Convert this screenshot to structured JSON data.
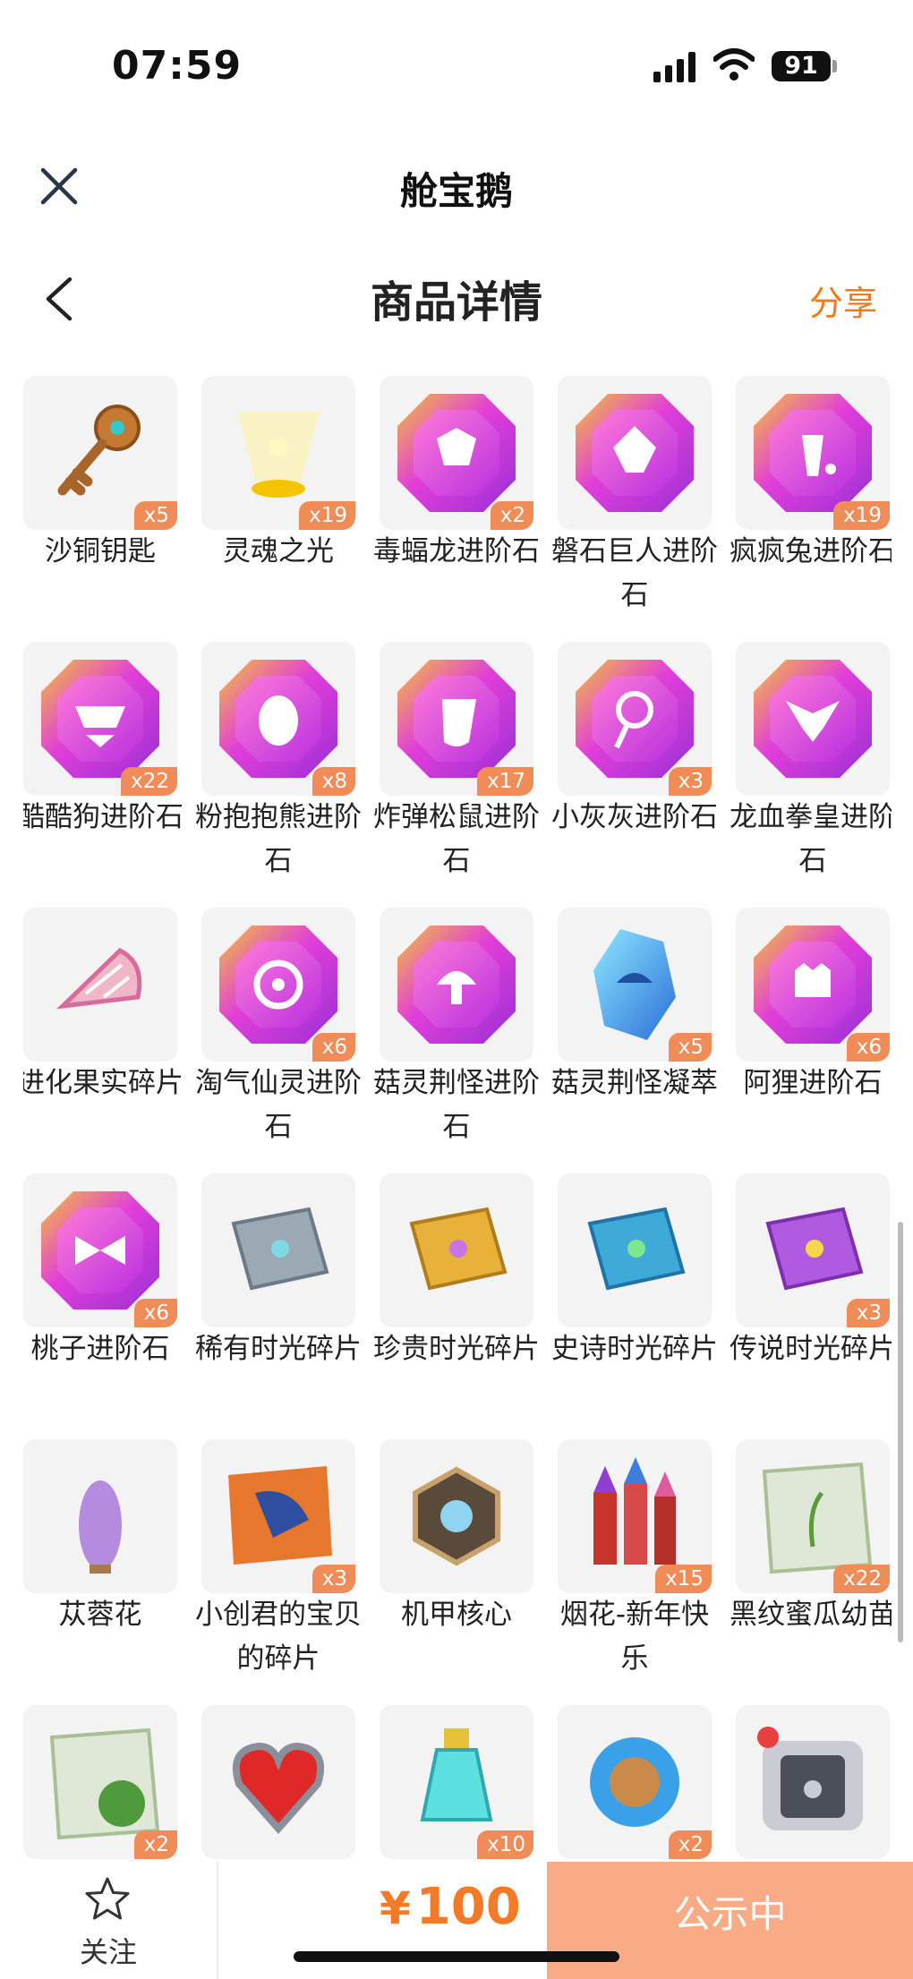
{
  "status_bar": {
    "time": "07:59",
    "battery": "91"
  },
  "header": {
    "app_title": "舱宝鹅",
    "close_icon": "close-icon"
  },
  "nav": {
    "title": "商品详情",
    "share_label": "分享",
    "back_icon": "chevron-left-icon"
  },
  "items": [
    {
      "name": "沙铜钥匙",
      "qty": "x5",
      "icon": "key-icon"
    },
    {
      "name": "灵魂之光",
      "qty": "x19",
      "icon": "light-icon"
    },
    {
      "name": "毒蝠龙进阶石",
      "qty": "x2",
      "icon": "gem-icon"
    },
    {
      "name": "磐石巨人进阶石",
      "qty": "",
      "icon": "gem-icon"
    },
    {
      "name": "疯疯兔进阶石",
      "qty": "x19",
      "icon": "gem-icon"
    },
    {
      "name": "酷酷狗进阶石",
      "qty": "x22",
      "icon": "gem-icon"
    },
    {
      "name": "粉抱抱熊进阶石",
      "qty": "x8",
      "icon": "gem-icon"
    },
    {
      "name": "炸弹松鼠进阶石",
      "qty": "x17",
      "icon": "gem-icon"
    },
    {
      "name": "小灰灰进阶石",
      "qty": "x3",
      "icon": "gem-icon"
    },
    {
      "name": "龙血拳皇进阶石",
      "qty": "",
      "icon": "gem-icon"
    },
    {
      "name": "进化果实碎片",
      "qty": "",
      "icon": "fruit-slice-icon"
    },
    {
      "name": "淘气仙灵进阶石",
      "qty": "x6",
      "icon": "gem-icon"
    },
    {
      "name": "菇灵荆怪进阶石",
      "qty": "",
      "icon": "gem-icon"
    },
    {
      "name": "菇灵荆怪凝萃",
      "qty": "x5",
      "icon": "crystal-icon"
    },
    {
      "name": "阿狸进阶石",
      "qty": "x6",
      "icon": "gem-icon"
    },
    {
      "name": "桃子进阶石",
      "qty": "x6",
      "icon": "gem-icon"
    },
    {
      "name": "稀有时光碎片",
      "qty": "",
      "icon": "puzzle-piece-icon"
    },
    {
      "name": "珍贵时光碎片",
      "qty": "",
      "icon": "puzzle-piece-icon"
    },
    {
      "name": "史诗时光碎片",
      "qty": "",
      "icon": "puzzle-piece-icon"
    },
    {
      "name": "传说时光碎片",
      "qty": "x3",
      "icon": "puzzle-piece-icon"
    },
    {
      "name": "苁蓉花",
      "qty": "",
      "icon": "flower-icon"
    },
    {
      "name": "小创君的宝贝的碎片",
      "qty": "x3",
      "icon": "jigsaw-icon"
    },
    {
      "name": "机甲核心",
      "qty": "",
      "icon": "mech-core-icon"
    },
    {
      "name": "烟花-新年快乐",
      "qty": "x15",
      "icon": "fireworks-icon"
    },
    {
      "name": "黑纹蜜瓜幼苗",
      "qty": "x22",
      "icon": "seed-packet-icon"
    },
    {
      "name": "",
      "qty": "x2",
      "icon": "seed-packet-icon"
    },
    {
      "name": "",
      "qty": "",
      "icon": "heart-gem-icon"
    },
    {
      "name": "",
      "qty": "x10",
      "icon": "potion-icon"
    },
    {
      "name": "",
      "qty": "x2",
      "icon": "orb-icon"
    },
    {
      "name": "",
      "qty": "",
      "icon": "pet-carrier-icon"
    }
  ],
  "bottom_bar": {
    "favorite_label": "关注",
    "currency": "¥",
    "price": "100",
    "cta_label": "公示中"
  },
  "colors": {
    "accent": "#f07a1a",
    "badge": "#ef8c58",
    "cta": "#f9ab85",
    "gem": "#d63dd6"
  }
}
